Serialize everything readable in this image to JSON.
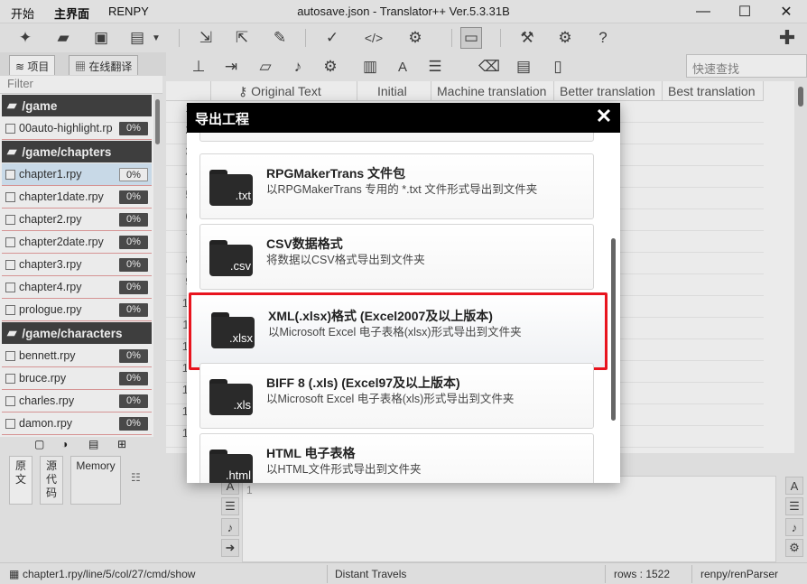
{
  "menu": {
    "items": [
      "开始",
      "主界面",
      "RENPY"
    ]
  },
  "window": {
    "title": "autosave.json - Translator++ Ver.5.3.31B",
    "minimize": "—",
    "maximize": "☐",
    "close": "✕"
  },
  "left_panel": {
    "tabs": [
      "项目",
      "在线翻译"
    ],
    "filter_placeholder": "Filter",
    "groups": [
      {
        "folder": "/game",
        "files": [
          {
            "name": "00auto-highlight.rp",
            "pct": "0%"
          }
        ]
      },
      {
        "folder": "/game/chapters",
        "files": [
          {
            "name": "chapter1.rpy",
            "pct": "0%",
            "selected": true
          },
          {
            "name": "chapter1date.rpy",
            "pct": "0%"
          },
          {
            "name": "chapter2.rpy",
            "pct": "0%"
          },
          {
            "name": "chapter2date.rpy",
            "pct": "0%"
          },
          {
            "name": "chapter3.rpy",
            "pct": "0%"
          },
          {
            "name": "chapter4.rpy",
            "pct": "0%"
          },
          {
            "name": "prologue.rpy",
            "pct": "0%"
          }
        ]
      },
      {
        "folder": "/game/characters",
        "files": [
          {
            "name": "bennett.rpy",
            "pct": "0%"
          },
          {
            "name": "bruce.rpy",
            "pct": "0%"
          },
          {
            "name": "charles.rpy",
            "pct": "0%"
          },
          {
            "name": "damon.rpy",
            "pct": "0%"
          }
        ]
      }
    ]
  },
  "grid": {
    "search_placeholder": "快速查找",
    "columns": [
      "Original Text",
      "Initial",
      "Machine translation",
      "Better translation",
      "Best translation"
    ],
    "row_numbers": [
      "1",
      "2",
      "3",
      "4",
      "5",
      "6",
      "7",
      "8",
      "9",
      "10",
      "11",
      "12",
      "13",
      "14",
      "15",
      "16"
    ]
  },
  "bottom": {
    "tabs": [
      "原\n文",
      "源\n代\n码",
      "Memory"
    ],
    "editor_line": "1"
  },
  "status": {
    "path": "chapter1.rpy/line/5/col/27/cmd/show",
    "project": "Distant Travels",
    "rows": "rows : 1522",
    "parser": "renpy/renParser"
  },
  "dialog": {
    "title": "导出工程",
    "options": [
      {
        "ext": ".txt",
        "title": "RPGMakerTrans 文件包",
        "desc": "以RPGMakerTrans 专用的 *.txt 文件形式导出到文件夹"
      },
      {
        "ext": ".csv",
        "title": "CSV数据格式",
        "desc": "将数据以CSV格式导出到文件夹"
      },
      {
        "ext": ".xlsx",
        "title": "XML(.xlsx)格式  (Excel2007及以上版本)",
        "desc": "以Microsoft Excel 电子表格(xlsx)形式导出到文件夹",
        "highlighted": true
      },
      {
        "ext": ".xls",
        "title": "BIFF 8 (.xls)   (Excel97及以上版本)",
        "desc": "以Microsoft Excel 电子表格(xls)形式导出到文件夹"
      },
      {
        "ext": ".html",
        "title": "HTML 电子表格",
        "desc": "以HTML文件形式导出到文件夹"
      }
    ]
  },
  "colors": {
    "highlight_border": "#e8141e",
    "folder_bg": "#444444",
    "dialog_title_bg": "#000000"
  }
}
